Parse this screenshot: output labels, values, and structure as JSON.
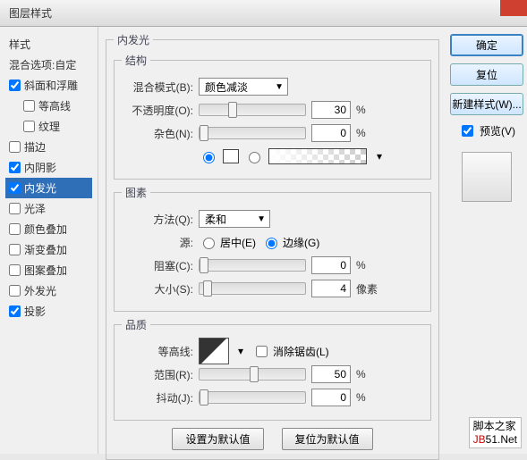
{
  "window": {
    "title": "图层样式"
  },
  "sidebar": {
    "styles_header": "样式",
    "blend_options": "混合选项:自定",
    "items": [
      {
        "label": "斜面和浮雕",
        "checked": true
      },
      {
        "label": "等高线",
        "checked": false,
        "sub": true
      },
      {
        "label": "纹理",
        "checked": false,
        "sub": true
      },
      {
        "label": "描边",
        "checked": false
      },
      {
        "label": "内阴影",
        "checked": true
      },
      {
        "label": "内发光",
        "checked": true,
        "selected": true
      },
      {
        "label": "光泽",
        "checked": false
      },
      {
        "label": "颜色叠加",
        "checked": false
      },
      {
        "label": "渐变叠加",
        "checked": false
      },
      {
        "label": "图案叠加",
        "checked": false
      },
      {
        "label": "外发光",
        "checked": false
      },
      {
        "label": "投影",
        "checked": true
      }
    ]
  },
  "panel": {
    "title": "内发光",
    "structure": {
      "legend": "结构",
      "blend_mode_label": "混合模式(B):",
      "blend_mode_value": "颜色减淡",
      "opacity_label": "不透明度(O):",
      "opacity_value": "30",
      "opacity_unit": "%",
      "noise_label": "杂色(N):",
      "noise_value": "0",
      "noise_unit": "%"
    },
    "elements": {
      "legend": "图素",
      "method_label": "方法(Q):",
      "method_value": "柔和",
      "source_label": "源:",
      "source_center": "居中(E)",
      "source_edge": "边缘(G)",
      "choke_label": "阻塞(C):",
      "choke_value": "0",
      "choke_unit": "%",
      "size_label": "大小(S):",
      "size_value": "4",
      "size_unit": "像素"
    },
    "quality": {
      "legend": "品质",
      "contour_label": "等高线:",
      "antialias": "消除锯齿(L)",
      "range_label": "范围(R):",
      "range_value": "50",
      "range_unit": "%",
      "jitter_label": "抖动(J):",
      "jitter_value": "0",
      "jitter_unit": "%"
    },
    "default_btns": {
      "set": "设置为默认值",
      "reset": "复位为默认值"
    }
  },
  "right": {
    "ok": "确定",
    "cancel": "复位",
    "new_style": "新建样式(W)...",
    "preview": "预览(V)"
  },
  "watermark": {
    "line1": "脚本之家",
    "line2": "JB51.Net"
  }
}
